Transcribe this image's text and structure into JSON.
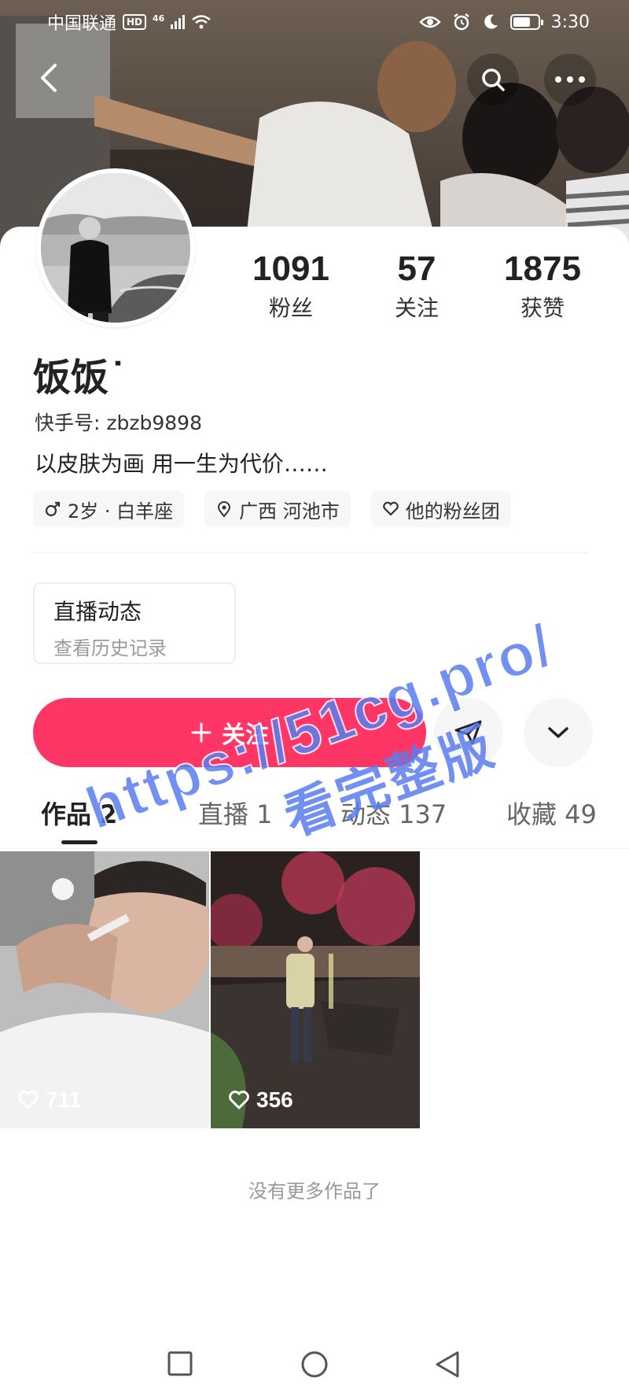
{
  "status_bar": {
    "carrier": "中国联通",
    "hd_badge": "HD",
    "network": "46",
    "time": "3:30"
  },
  "header": {
    "back_icon": "chevron-left-icon",
    "search_icon": "search-icon",
    "more_icon": "more-dots-icon"
  },
  "profile": {
    "name": "饭饭˙",
    "kuaishou_id": "快手号: zbzb9898",
    "bio": "以皮肤为画 用一生为代价……",
    "stats": [
      {
        "value": "1091",
        "label": "粉丝"
      },
      {
        "value": "57",
        "label": "关注"
      },
      {
        "value": "1875",
        "label": "获赞"
      }
    ],
    "tags": [
      {
        "icon": "male-icon",
        "text": "2岁 · 白羊座"
      },
      {
        "icon": "location-pin-icon",
        "text": "广西 河池市"
      },
      {
        "icon": "heart-icon",
        "text": "他的粉丝团"
      }
    ]
  },
  "live_box": {
    "title": "直播动态",
    "subtitle": "查看历史记录"
  },
  "actions": {
    "follow_label": "关注",
    "follow_icon": "plus-icon",
    "share_icon": "send-icon",
    "more_icon": "chevron-down-icon",
    "accent": "#fe3666"
  },
  "tabs": [
    {
      "label": "作品 2",
      "active": true
    },
    {
      "label": "直播 1",
      "active": false
    },
    {
      "label": "动态 137",
      "active": false
    },
    {
      "label": "收藏 49",
      "active": false
    }
  ],
  "works": [
    {
      "likes": "711"
    },
    {
      "likes": "356"
    }
  ],
  "no_more": "没有更多作品了",
  "watermark": {
    "url": "https://51cg.pro/",
    "text": "看完整版"
  }
}
